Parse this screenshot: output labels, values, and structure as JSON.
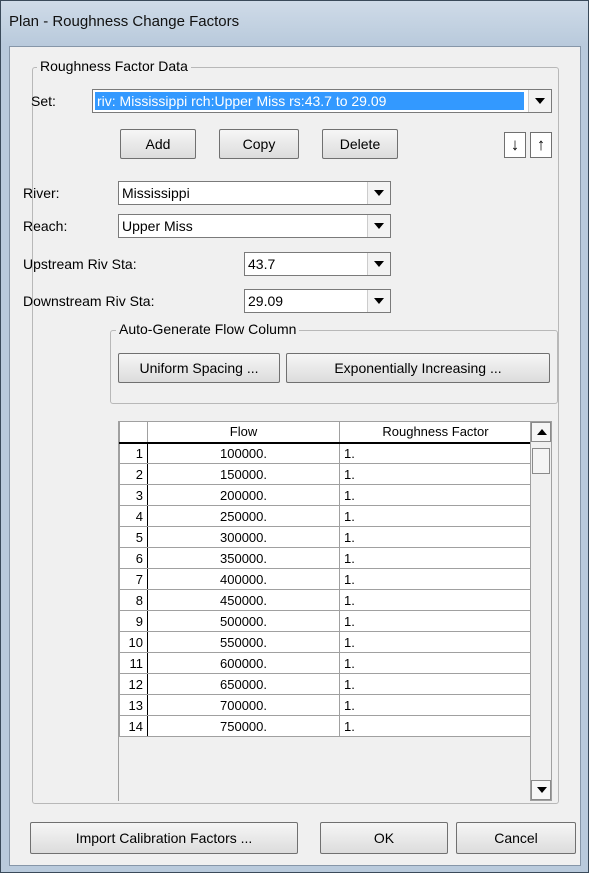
{
  "window": {
    "title": "Plan - Roughness Change Factors"
  },
  "group": {
    "label": "Roughness Factor Data"
  },
  "set": {
    "label": "Set:",
    "value": "riv: Mississippi rch:Upper Miss rs:43.7  to 29.09"
  },
  "buttons": {
    "add": "Add",
    "copy": "Copy",
    "delete": "Delete",
    "down_arrow": "↓",
    "up_arrow": "↑"
  },
  "river": {
    "label": "River:",
    "value": "Mississippi"
  },
  "reach": {
    "label": "Reach:",
    "value": "Upper Miss"
  },
  "upstream": {
    "label": "Upstream Riv Sta:",
    "value": "43.7"
  },
  "downstream": {
    "label": "Downstream Riv Sta:",
    "value": "29.09"
  },
  "autogen": {
    "label": "Auto-Generate Flow Column",
    "uniform": "Uniform Spacing ...",
    "exponential": "Exponentially Increasing ..."
  },
  "table": {
    "headers": [
      "",
      "Flow",
      "Roughness Factor"
    ],
    "rows": [
      [
        "1",
        "100000.",
        "1."
      ],
      [
        "2",
        "150000.",
        "1."
      ],
      [
        "3",
        "200000.",
        "1."
      ],
      [
        "4",
        "250000.",
        "1."
      ],
      [
        "5",
        "300000.",
        "1."
      ],
      [
        "6",
        "350000.",
        "1."
      ],
      [
        "7",
        "400000.",
        "1."
      ],
      [
        "8",
        "450000.",
        "1."
      ],
      [
        "9",
        "500000.",
        "1."
      ],
      [
        "10",
        "550000.",
        "1."
      ],
      [
        "11",
        "600000.",
        "1."
      ],
      [
        "12",
        "650000.",
        "1."
      ],
      [
        "13",
        "700000.",
        "1."
      ],
      [
        "14",
        "750000.",
        "1."
      ]
    ]
  },
  "footer": {
    "import": "Import Calibration Factors ...",
    "ok": "OK",
    "cancel": "Cancel"
  }
}
